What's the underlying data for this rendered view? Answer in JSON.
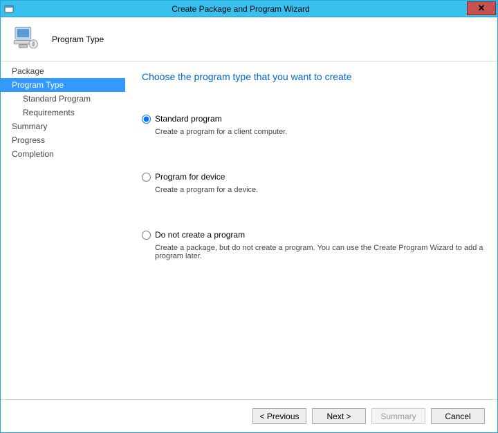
{
  "window": {
    "title": "Create Package and Program Wizard"
  },
  "header": {
    "title": "Program Type"
  },
  "sidebar": {
    "items": [
      {
        "label": "Package",
        "child": false,
        "active": false
      },
      {
        "label": "Program Type",
        "child": false,
        "active": true
      },
      {
        "label": "Standard Program",
        "child": true,
        "active": false
      },
      {
        "label": "Requirements",
        "child": true,
        "active": false
      },
      {
        "label": "Summary",
        "child": false,
        "active": false
      },
      {
        "label": "Progress",
        "child": false,
        "active": false
      },
      {
        "label": "Completion",
        "child": false,
        "active": false
      }
    ]
  },
  "content": {
    "heading": "Choose the program type that you want to create",
    "options": [
      {
        "id": "standard",
        "label": "Standard program",
        "desc": "Create a program for a client computer.",
        "selected": true
      },
      {
        "id": "device",
        "label": "Program for device",
        "desc": "Create a program for a device.",
        "selected": false
      },
      {
        "id": "none",
        "label": "Do not create a program",
        "desc": "Create a package, but do not create a program. You can use the Create Program Wizard to add a program later.",
        "selected": false
      }
    ]
  },
  "footer": {
    "previous": "< Previous",
    "next": "Next >",
    "summary": "Summary",
    "cancel": "Cancel"
  }
}
